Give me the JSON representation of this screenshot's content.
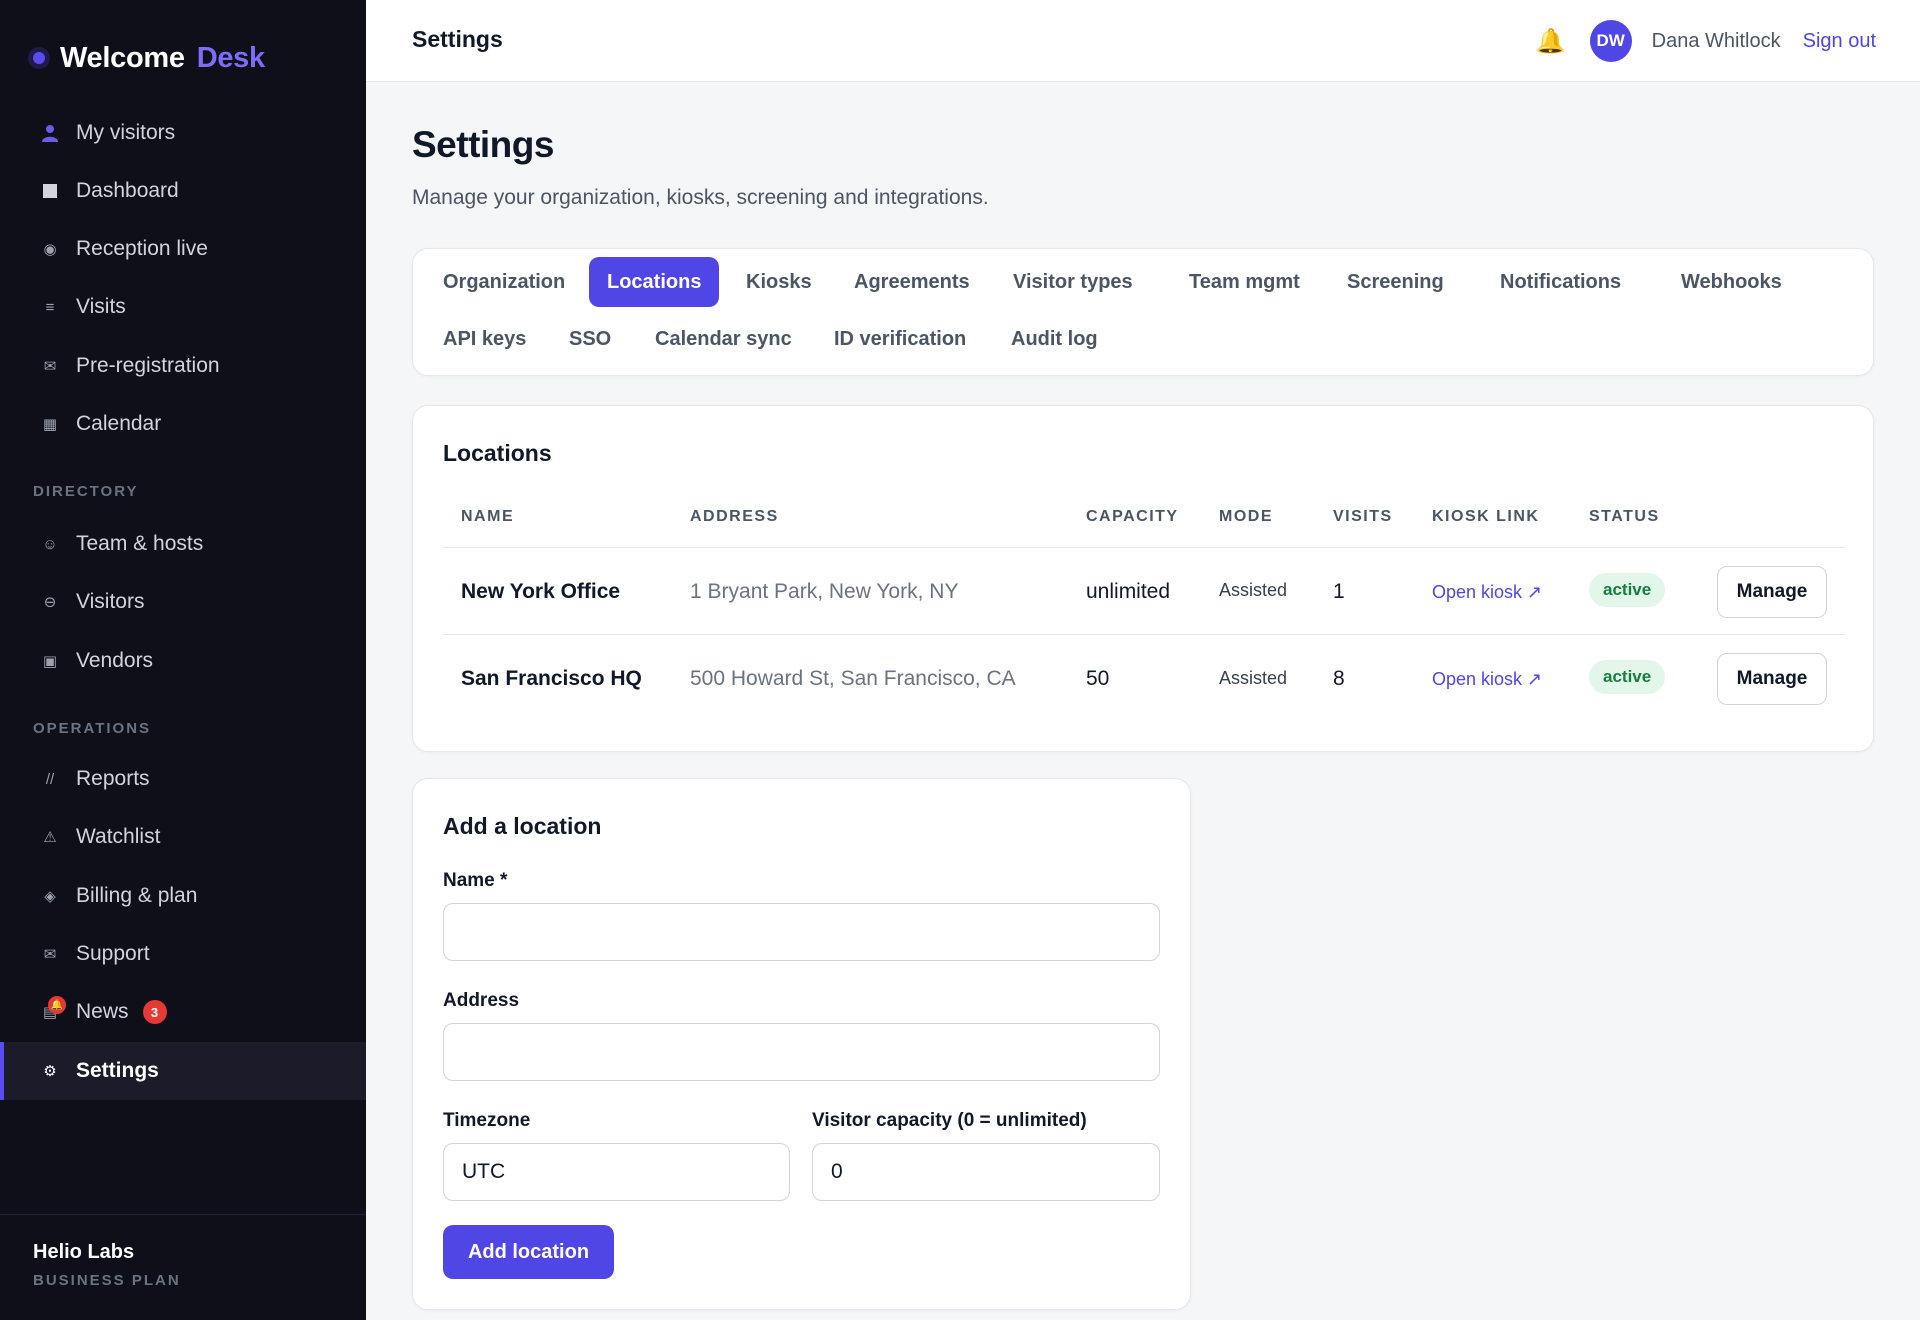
{
  "brand": {
    "name": "Welcome",
    "accent": "Desk"
  },
  "sidebar": {
    "items": [
      {
        "label": "My visitors",
        "icon": "person-icon"
      },
      {
        "label": "Dashboard",
        "icon": "square-icon"
      },
      {
        "label": "Reception live",
        "icon": "radio-icon"
      },
      {
        "label": "Visits",
        "icon": "list-icon"
      },
      {
        "label": "Pre-registration",
        "icon": "mail-icon"
      },
      {
        "label": "Calendar",
        "icon": "grid-icon"
      }
    ],
    "directory_label": "DIRECTORY",
    "directory": [
      {
        "label": "Team & hosts",
        "icon": "smile-icon"
      },
      {
        "label": "Visitors",
        "icon": "circle-minus-icon"
      },
      {
        "label": "Vendors",
        "icon": "box-icon"
      }
    ],
    "operations_label": "OPERATIONS",
    "operations": [
      {
        "label": "Reports",
        "icon": "slash-icon"
      },
      {
        "label": "Watchlist",
        "icon": "warning-icon"
      },
      {
        "label": "Billing & plan",
        "icon": "diamond-icon"
      },
      {
        "label": "Support",
        "icon": "mail-icon"
      },
      {
        "label": "News",
        "icon": "newspaper-icon",
        "badge": "3"
      },
      {
        "label": "Settings",
        "icon": "gear-icon"
      }
    ],
    "footer": {
      "org": "Helio Labs",
      "plan": "BUSINESS PLAN"
    }
  },
  "topbar": {
    "title": "Settings",
    "avatar": "DW",
    "user": "Dana Whitlock",
    "sign_out": "Sign out"
  },
  "page": {
    "title": "Settings",
    "subtitle": "Manage your organization, kiosks, screening and integrations."
  },
  "tabs": [
    "Organization",
    "Locations",
    "Kiosks",
    "Agreements",
    "Visitor types",
    "Team mgmt",
    "Screening",
    "Notifications",
    "Webhooks",
    "API keys",
    "SSO",
    "Calendar sync",
    "ID verification",
    "Audit log"
  ],
  "active_tab": "Locations",
  "locations": {
    "title": "Locations",
    "columns": [
      "NAME",
      "ADDRESS",
      "CAPACITY",
      "MODE",
      "VISITS",
      "KIOSK LINK",
      "STATUS"
    ],
    "rows": [
      {
        "name": "New York Office",
        "address": "1 Bryant Park, New York, NY",
        "capacity": "unlimited",
        "mode": "Assisted",
        "visits": "1",
        "kiosk": "Open kiosk ↗",
        "status": "active",
        "action": "Manage"
      },
      {
        "name": "San Francisco HQ",
        "address": "500 Howard St, San Francisco, CA",
        "capacity": "50",
        "mode": "Assisted",
        "visits": "8",
        "kiosk": "Open kiosk ↗",
        "status": "active",
        "action": "Manage"
      }
    ]
  },
  "add_location": {
    "title": "Add a location",
    "name_label": "Name *",
    "name_value": "",
    "address_label": "Address",
    "address_value": "",
    "timezone_label": "Timezone",
    "timezone_value": "UTC",
    "capacity_label": "Visitor capacity (0 = unlimited)",
    "capacity_value": "0",
    "submit": "Add location"
  },
  "colors": {
    "accent": "#4f46e5",
    "sidebar_bg": "#0f0f1a",
    "status_green": "#15803d"
  }
}
